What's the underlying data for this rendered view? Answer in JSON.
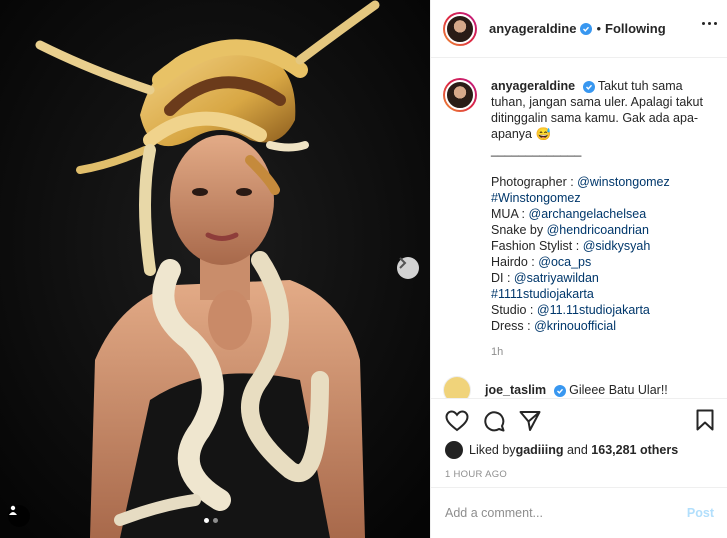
{
  "post": {
    "author": "anyageraldine",
    "follow_status": "Following",
    "separator": "•",
    "time_ago": "1h",
    "caption_lines": [
      "Takut tuh sama",
      "tuhan, jangan sama uler. Apalagi takut",
      "ditinggalin sama kamu. Gak ada apa-",
      "apanya 😅"
    ],
    "divider": "_____________",
    "credits": [
      {
        "label": "Photographer : ",
        "mention": "@winstongomez"
      },
      {
        "label": "",
        "mention": "#Winstongomez"
      },
      {
        "label": "MUA : ",
        "mention": "@archangelachelsea"
      },
      {
        "label": "Snake by ",
        "mention": "@hendricoandrian"
      },
      {
        "label": "Fashion Stylist : ",
        "mention": "@sidkysyah"
      },
      {
        "label": "Hairdo : ",
        "mention": "@oca_ps"
      },
      {
        "label": "DI : ",
        "mention": "@satriyawildan"
      },
      {
        "label": "",
        "mention": "#1111studiojakarta"
      },
      {
        "label": "Studio : ",
        "mention": "@11.11studiojakarta"
      },
      {
        "label": "Dress : ",
        "mention": "@krinouofficial"
      }
    ],
    "next_comment": {
      "user": "joe_taslim",
      "text": "Gileee Batu Ular!!"
    },
    "likes": {
      "prefix": "Liked by ",
      "user": "gadiiing",
      "middle": " and ",
      "count": "163,281 others"
    },
    "posted": "1 HOUR AGO",
    "comment_placeholder": "Add a comment...",
    "post_label": "Post"
  },
  "carousel": {
    "total": 2,
    "active": 0
  },
  "icons": [
    "heart-icon",
    "comment-icon",
    "share-icon",
    "bookmark-icon",
    "chevron-right-icon",
    "user-tag-icon",
    "verified-icon",
    "more-icon"
  ],
  "colors": {
    "link": "#00376b",
    "verified": "#3897f0",
    "post_disabled": "#b2dffc",
    "muted": "#8e8e8e"
  }
}
